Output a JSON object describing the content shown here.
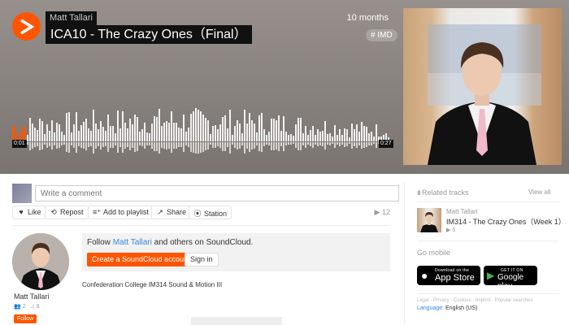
{
  "player": {
    "artist": "Matt Tallari",
    "title": "ICA10 - The Crazy Ones（Final）",
    "posted": "10 months",
    "tag": "# IMD",
    "time_start": "0:01",
    "time_end": "0:27",
    "progress_fraction": 0.04,
    "accent_color": "#ff5500"
  },
  "comment": {
    "placeholder": "Write a comment"
  },
  "actions": {
    "like": "Like",
    "repost": "Repost",
    "add_to_playlist": "Add to playlist",
    "share": "Share",
    "station": "Station",
    "plays": "12"
  },
  "user": {
    "name": "Matt Tallari",
    "followers": "2",
    "tracks": "8",
    "follow_label": "Follow"
  },
  "follow_box": {
    "prefix": "Follow ",
    "name": "Matt Tallari",
    "suffix": " and others on SoundCloud.",
    "create_label": "Create a SoundCloud account",
    "signin_label": "Sign in"
  },
  "description": "Confederation College IM314 Sound & Motion III",
  "sidebar": {
    "related_heading": "Related tracks",
    "view_all": "View all",
    "related": {
      "artist": "Matt Tallari",
      "title": "IM314 - The Crazy Ones（Week 1）",
      "plays": "5"
    },
    "go_mobile": "Go mobile",
    "app_store_small": "Download on the",
    "app_store_big": "App Store",
    "google_small": "GET IT ON",
    "google_big": "Google play",
    "legal": "Legal · Privacy · Cookies · Imprint · Popular searches",
    "language_label": "Language:",
    "language_value": "English (US)"
  }
}
